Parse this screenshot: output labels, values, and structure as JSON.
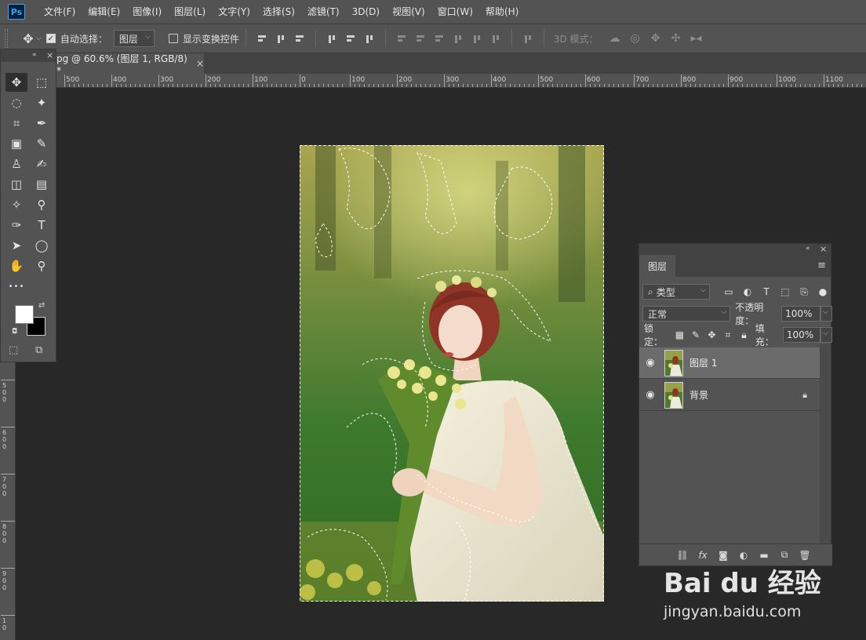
{
  "app": {
    "logo": "Ps"
  },
  "menu": [
    "文件(F)",
    "编辑(E)",
    "图像(I)",
    "图层(L)",
    "文字(Y)",
    "选择(S)",
    "滤镜(T)",
    "3D(D)",
    "视图(V)",
    "窗口(W)",
    "帮助(H)"
  ],
  "options": {
    "auto_select_label": "自动选择：",
    "auto_select_checked": true,
    "auto_select_value": "图层",
    "show_transform_label": "显示变换控件",
    "show_transform_checked": false,
    "mode_3d_label": "3D 模式："
  },
  "document": {
    "tab_title": "pg @ 60.6% (图层 1, RGB/8) *",
    "close": "×"
  },
  "ruler": {
    "top_labels": [
      "500",
      "400",
      "300",
      "200",
      "100",
      "0",
      "100",
      "200",
      "300",
      "400",
      "500",
      "600",
      "700",
      "800",
      "900",
      "1000",
      "1100"
    ],
    "left_labels": [
      "500",
      "600",
      "700",
      "800",
      "900",
      "10"
    ]
  },
  "tools": [
    {
      "name": "move-tool",
      "glyph": "✥",
      "active": true
    },
    {
      "name": "marquee-tool",
      "glyph": "⬚"
    },
    {
      "name": "lasso-tool",
      "glyph": "◌"
    },
    {
      "name": "magic-wand-tool",
      "glyph": "✦"
    },
    {
      "name": "crop-tool",
      "glyph": "⌗"
    },
    {
      "name": "eyedropper-tool",
      "glyph": "✒"
    },
    {
      "name": "patch-tool",
      "glyph": "▣"
    },
    {
      "name": "brush-tool",
      "glyph": "✎"
    },
    {
      "name": "stamp-tool",
      "glyph": "♙"
    },
    {
      "name": "history-brush-tool",
      "glyph": "✍"
    },
    {
      "name": "eraser-tool",
      "glyph": "◫"
    },
    {
      "name": "gradient-tool",
      "glyph": "▤"
    },
    {
      "name": "blur-tool",
      "glyph": "✧"
    },
    {
      "name": "dodge-tool",
      "glyph": "⚲"
    },
    {
      "name": "pen-tool",
      "glyph": "✑"
    },
    {
      "name": "type-tool",
      "glyph": "T"
    },
    {
      "name": "path-select-tool",
      "glyph": "➤"
    },
    {
      "name": "ellipse-tool",
      "glyph": "◯"
    },
    {
      "name": "hand-tool",
      "glyph": "✋"
    },
    {
      "name": "zoom-tool",
      "glyph": "⚲"
    },
    {
      "name": "more-tools",
      "glyph": "•••"
    }
  ],
  "layers_panel": {
    "tab_label": "图层",
    "filter_kind": "类型",
    "blend_mode": "正常",
    "opacity_label": "不透明度：",
    "opacity_value": "100%",
    "lock_label": "锁定：",
    "fill_label": "填充：",
    "fill_value": "100%",
    "layers": [
      {
        "name": "图层 1",
        "selected": true,
        "locked": false,
        "visible": true
      },
      {
        "name": "背景",
        "selected": false,
        "locked": true,
        "visible": true
      }
    ]
  },
  "watermark": {
    "logo": "Bai du 经验",
    "url": "jingyan.baidu.com"
  }
}
